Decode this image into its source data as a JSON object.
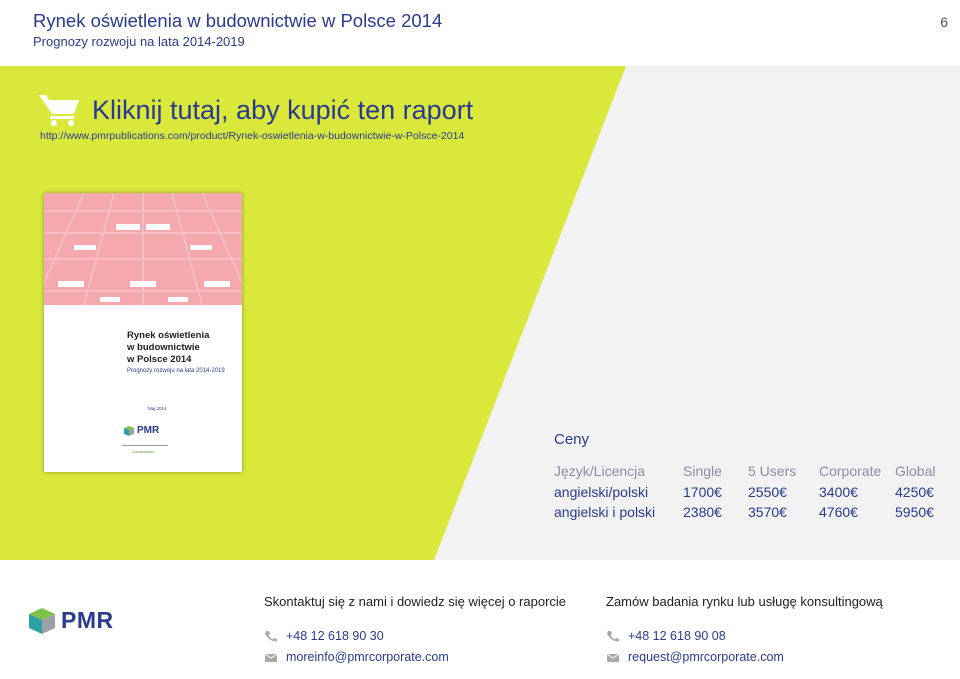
{
  "header": {
    "title": "Rynek oświetlenia w budownictwie w Polsce 2014",
    "subtitle": "Prognozy rozwoju na lata 2014-2019",
    "page_number": "6"
  },
  "buy": {
    "label": "Kliknij tutaj, aby kupić ten raport",
    "url": "http://www.pmrpublications.com/product/Rynek-oswietlenia-w-budownictwie-w-Polsce-2014",
    "icon": "cart-icon"
  },
  "cover": {
    "title": "Rynek oświetlenia\nw budownictwie\nw Polsce 2014",
    "subtitle": "Prognozy rozwoju na lata 2014-2019",
    "date": "Maj 2014",
    "logo_text": "PMR",
    "sub_logo_text": "Construction"
  },
  "prices": {
    "heading": "Ceny",
    "columns": [
      "Język/Licencja",
      "Single",
      "5 Users",
      "Corporate",
      "Global"
    ],
    "rows": [
      [
        "angielski/polski",
        "1700€",
        "2550€",
        "3400€",
        "4250€"
      ],
      [
        "angielski i polski",
        "2380€",
        "3570€",
        "4760€",
        "5950€"
      ]
    ]
  },
  "footer": {
    "logo_text": "PMR",
    "contact1": {
      "heading": "Skontaktuj się z nami i dowiedz się więcej o raporcie",
      "phone": "+48 12 618 90 30",
      "email": "moreinfo@pmrcorporate.com"
    },
    "contact2": {
      "heading": "Zamów badania rynku lub usługę konsultingową",
      "phone": "+48 12 618 90 08",
      "email": "request@pmrcorporate.com"
    }
  },
  "colors": {
    "accent_green": "#d9e83b",
    "brand_blue": "#2a3b8f",
    "cover_pink": "#f5a9ae"
  }
}
